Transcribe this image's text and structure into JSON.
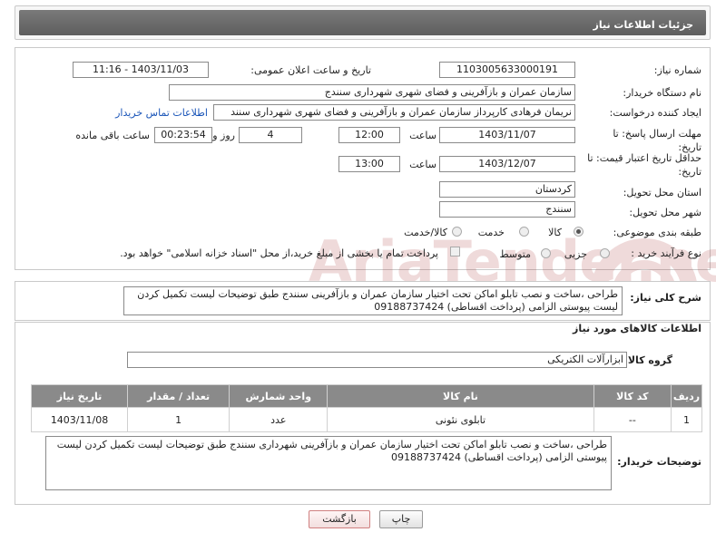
{
  "header": {
    "title": "جزئیات اطلاعات نیاز"
  },
  "form": {
    "need_number_label": "شماره نیاز:",
    "need_number": "1103005633000191",
    "announce_label": "تاریخ و ساعت اعلان عمومی:",
    "announce_value": "1403/11/03 - 11:16",
    "buyer_org_label": "نام دستگاه خریدار:",
    "buyer_org": "سازمان عمران و بازآفرینی و فضای شهری شهرداری سنندج",
    "creator_label": "ایجاد کننده درخواست:",
    "creator": "نریمان فرهادی کارپرداز سازمان عمران و بازآفرینی و فضای شهری شهرداری سنند",
    "contact_link": "اطلاعات تماس خریدار",
    "deadline_label": "مهلت ارسال پاسخ: تا تاریخ:",
    "deadline_date": "1403/11/07",
    "time_label": "ساعت",
    "deadline_time": "12:00",
    "days_value": "4",
    "days_label": "روز و",
    "remaining_time": "00:23:54",
    "remaining_label": "ساعت باقی مانده",
    "validity_label": "حداقل تاریخ اعتبار قیمت: تا تاریخ:",
    "validity_date": "1403/12/07",
    "validity_time": "13:00",
    "province_label": "استان محل تحویل:",
    "province": "کردستان",
    "city_label": "شهر محل تحویل:",
    "city": "سنندج",
    "category_label": "طبقه بندی موضوعی:",
    "category_options": [
      "کالا",
      "خدمت",
      "کالا/خدمت"
    ],
    "category_selected": "کالا",
    "process_label": "نوع فرآیند خرید :",
    "process_options": [
      "جزیی",
      "متوسط"
    ],
    "process_note": "پرداخت تمام یا بخشی از مبلغ خرید،از محل \"اسناد خزانه اسلامی\" خواهد بود."
  },
  "summary": {
    "label": "شرح کلی نیاز:",
    "text": "طراحی ،ساخت و نصب تابلو اماکن تحت اختیار سازمان عمران و بازآفرینی سنندج طبق توضیحات لیست تکمیل کردن لیست پیوستی الزامی (پرداخت اقساطی) 09188737424"
  },
  "goods": {
    "section_title": "اطلاعات کالاهای مورد نیاز",
    "group_label": "گروه کالا:",
    "group_value": "ابزارآلات الکتریکی",
    "columns": [
      "ردیف",
      "کد کالا",
      "نام کالا",
      "واحد شمارش",
      "تعداد / مقدار",
      "تاریخ نیاز"
    ],
    "rows": [
      {
        "row": "1",
        "code": "--",
        "name": "تابلوی نئونی",
        "unit": "عدد",
        "qty": "1",
        "date": "1403/11/08"
      }
    ]
  },
  "buyer_notes": {
    "label": "توضیحات خریدار:",
    "text": "طراحی ،ساخت و نصب تابلو اماکن تحت اختیار سازمان عمران و بازآفرینی شهرداری سنندج طبق توضیحات لیست تکمیل کردن لیست پیوستی الزامی (پرداخت اقساطی) 09188737424"
  },
  "buttons": {
    "print": "چاپ",
    "back": "بازگشت"
  },
  "watermark": {
    "text": "AriaTender.neT"
  },
  "colors": {
    "header_bar": "#6b6b6b",
    "table_header": "#8a8a8a",
    "link": "#1a55b8",
    "back_button_border": "#d08080"
  }
}
